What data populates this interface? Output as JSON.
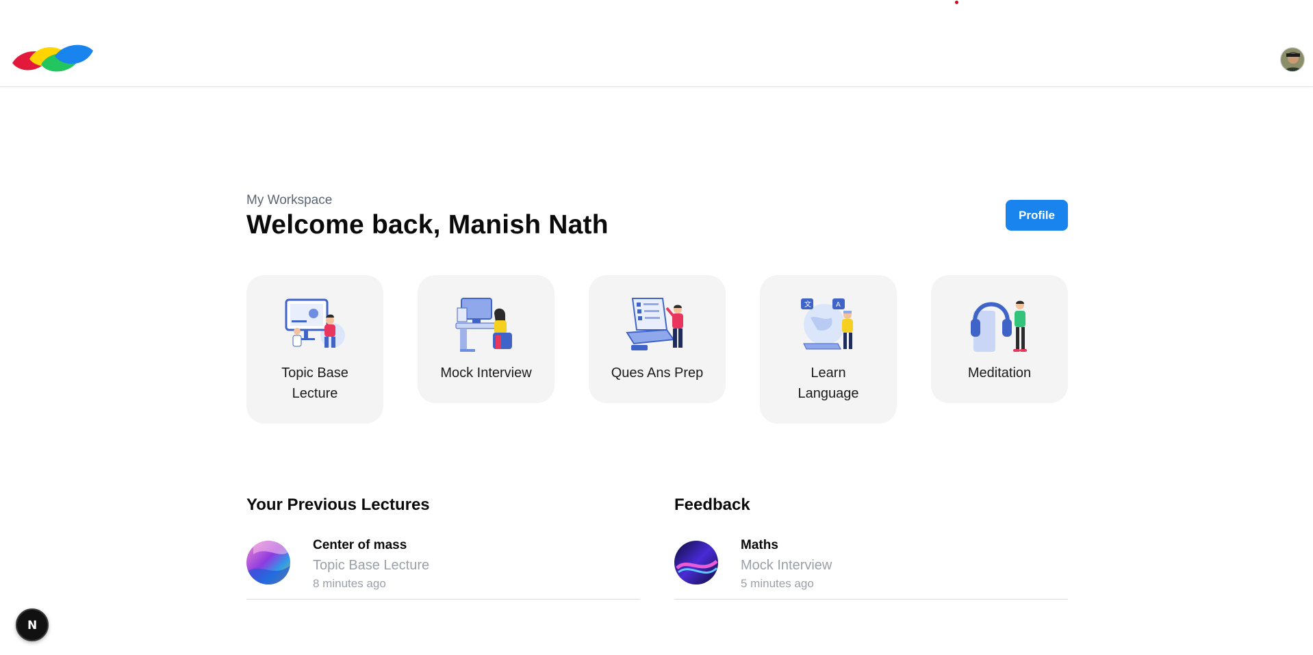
{
  "header": {
    "logo_icon": "multicolor-leaf-logo-icon",
    "avatar_icon": "user-avatar-icon"
  },
  "workspace": {
    "label": "My Workspace",
    "welcome": "Welcome back, Manish Nath",
    "profile_label": "Profile"
  },
  "cards": [
    {
      "label": "Topic Base Lecture",
      "icon": "lecture-illustration-icon"
    },
    {
      "label": "Mock Interview",
      "icon": "interview-illustration-icon"
    },
    {
      "label": "Ques Ans Prep",
      "icon": "laptop-quiz-illustration-icon"
    },
    {
      "label": "Learn Language",
      "icon": "globe-language-illustration-icon"
    },
    {
      "label": "Meditation",
      "icon": "headphones-illustration-icon"
    }
  ],
  "previous_lectures": {
    "title": "Your Previous Lectures",
    "items": [
      {
        "title": "Center of mass",
        "type": "Topic Base Lecture",
        "time": "8 minutes ago"
      }
    ]
  },
  "feedback": {
    "title": "Feedback",
    "items": [
      {
        "title": "Maths",
        "type": "Mock Interview",
        "time": "5 minutes ago"
      }
    ]
  },
  "colors": {
    "accent": "#1a84ee",
    "card_bg": "#f4f4f5",
    "muted_text": "#9aa0a8"
  },
  "floating": {
    "icon": "nextjs-badge-icon",
    "letter": "N"
  }
}
